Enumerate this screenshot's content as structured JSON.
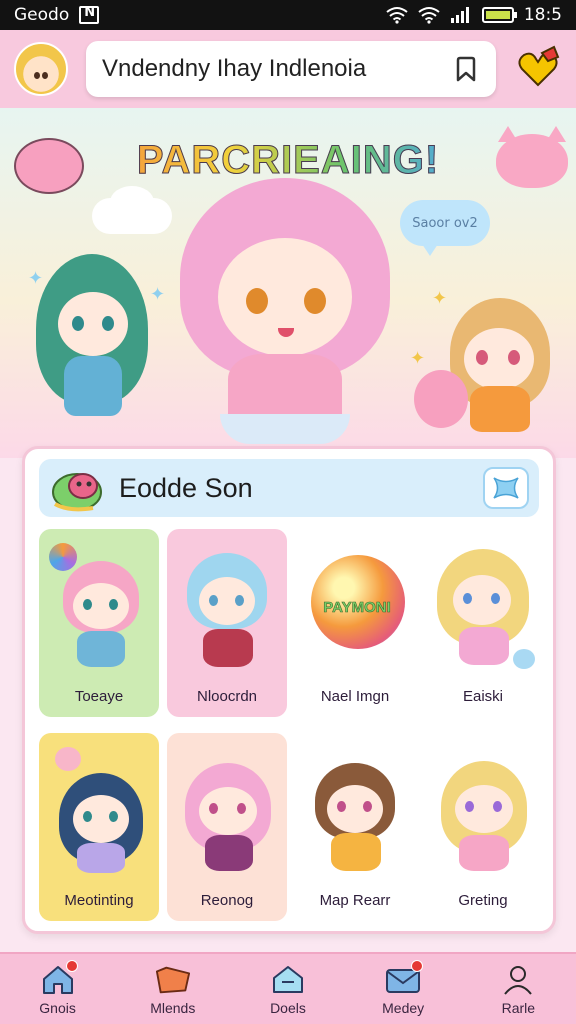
{
  "status_bar": {
    "carrier": "Geodo",
    "time": "18:5"
  },
  "top_bar": {
    "search_text": "Vndendny Ihay Indlenoia"
  },
  "hero": {
    "title": "PARCRIEAING!",
    "bubble_text": "Saoor ov2"
  },
  "panel": {
    "title": "Eodde Son",
    "cards": [
      {
        "label": "Toeaye",
        "bg": "#cdebb3"
      },
      {
        "label": "Nloocrdn",
        "bg": "#f9c9dd"
      },
      {
        "label": "Nael Imgn",
        "bg": "#ffffff"
      },
      {
        "label": "Eaiski",
        "bg": "#ffffff"
      },
      {
        "label": "Meotinting",
        "bg": "#f8e07c"
      },
      {
        "label": "Reonog",
        "bg": "#fde1d6"
      },
      {
        "label": "Map Rearr",
        "bg": "#ffffff"
      },
      {
        "label": "Greting",
        "bg": "#ffffff"
      }
    ],
    "badge_text": "PAYMONI"
  },
  "bottom_nav": {
    "items": [
      {
        "label": "Gnois",
        "icon": "home-icon"
      },
      {
        "label": "Mlends",
        "icon": "ticket-icon"
      },
      {
        "label": "Doels",
        "icon": "chat-home-icon"
      },
      {
        "label": "Medey",
        "icon": "mail-icon"
      },
      {
        "label": "Rarle",
        "icon": "profile-icon"
      }
    ]
  }
}
